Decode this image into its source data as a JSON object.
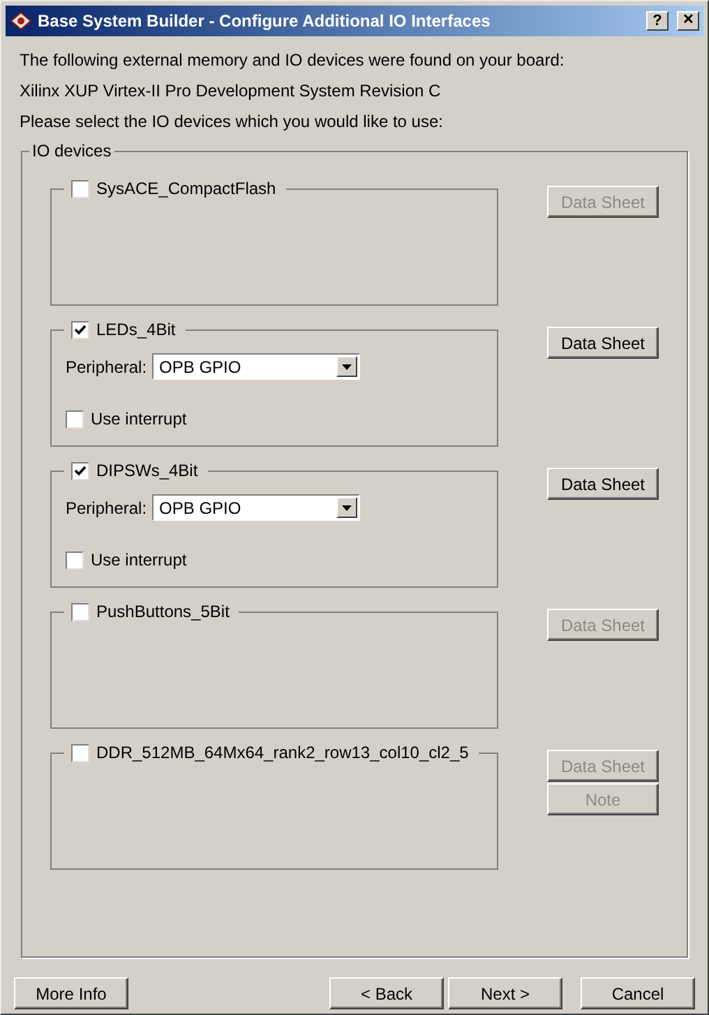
{
  "window": {
    "title": "Base System Builder - Configure Additional IO Interfaces",
    "help_button": "?",
    "close_button": "✕"
  },
  "intro": [
    "The following external memory and IO devices were found on your board:",
    "Xilinx XUP Virtex-II Pro Development System Revision C",
    "Please select the IO devices which you would like to use:"
  ],
  "group": {
    "title": "IO devices",
    "devices": [
      {
        "name": "SysACE_CompactFlash",
        "checked": false,
        "buttons": [
          {
            "label": "Data Sheet",
            "disabled": true
          }
        ]
      },
      {
        "name": "LEDs_4Bit",
        "checked": true,
        "options": [
          {
            "kind": "dropdown",
            "label": "Peripheral:",
            "value": "OPB GPIO"
          },
          {
            "kind": "checkbox",
            "label": "Use interrupt",
            "checked": false
          }
        ],
        "buttons": [
          {
            "label": "Data Sheet",
            "disabled": false
          }
        ]
      },
      {
        "name": "DIPSWs_4Bit",
        "checked": true,
        "options": [
          {
            "kind": "dropdown",
            "label": "Peripheral:",
            "value": "OPB GPIO"
          },
          {
            "kind": "checkbox",
            "label": "Use interrupt",
            "checked": false
          }
        ],
        "buttons": [
          {
            "label": "Data Sheet",
            "disabled": false
          }
        ]
      },
      {
        "name": "PushButtons_5Bit",
        "checked": false,
        "buttons": [
          {
            "label": "Data Sheet",
            "disabled": true
          }
        ]
      },
      {
        "name": "DDR_512MB_64Mx64_rank2_row13_col10_cl2_5",
        "checked": false,
        "buttons": [
          {
            "label": "Data Sheet",
            "disabled": true
          },
          {
            "label": "Note",
            "disabled": true
          }
        ]
      }
    ]
  },
  "footer": {
    "left": [
      {
        "label": "More Info"
      }
    ],
    "right": [
      {
        "label": "< Back"
      },
      {
        "label": "Next >"
      },
      {
        "label": "Cancel"
      }
    ]
  }
}
